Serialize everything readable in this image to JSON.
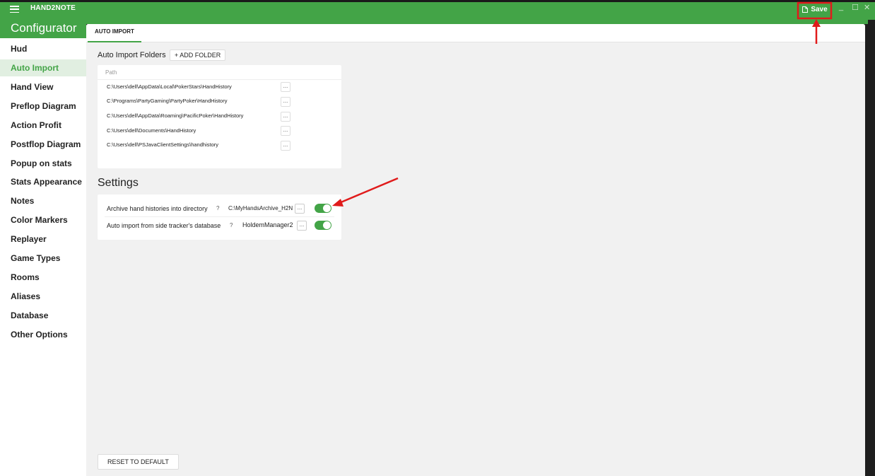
{
  "app": {
    "name": "HAND2NOTE"
  },
  "titlebar": {
    "save_label": "Save",
    "minimize": "_",
    "maximize": "☐",
    "close": "✕"
  },
  "sidebar": {
    "title": "Configurator",
    "items": [
      {
        "label": "Hud"
      },
      {
        "label": "Auto Import",
        "active": true
      },
      {
        "label": "Hand View"
      },
      {
        "label": "Preflop Diagram"
      },
      {
        "label": "Action Profit"
      },
      {
        "label": "Postflop Diagram"
      },
      {
        "label": "Popup on stats"
      },
      {
        "label": "Stats Appearance"
      },
      {
        "label": "Notes"
      },
      {
        "label": "Color Markers"
      },
      {
        "label": "Replayer"
      },
      {
        "label": "Game Types"
      },
      {
        "label": "Rooms"
      },
      {
        "label": "Aliases"
      },
      {
        "label": "Database"
      },
      {
        "label": "Other Options"
      }
    ]
  },
  "tabs": [
    {
      "label": "AUTO IMPORT",
      "active": true
    }
  ],
  "auto_import": {
    "folders_label": "Auto Import Folders",
    "add_folder_label": "+ ADD FOLDER",
    "path_header": "Path",
    "browse_label": "...",
    "paths": [
      "C:\\Users\\dell\\AppData\\Local\\PokerStars\\HandHistory",
      "C:\\Programs\\PartyGaming\\PartyPoker\\HandHistory",
      "C:\\Users\\dell\\AppData\\Roaming\\PacificPoker\\HandHistory",
      "C:\\Users\\dell\\Documents\\HandHistory",
      "C:\\Users\\dell\\PSJavaClientSettings\\handhistory"
    ]
  },
  "settings": {
    "title": "Settings",
    "help": "?",
    "rows": [
      {
        "label": "Archive hand histories into directory",
        "value": "C:\\MyHandsArchive_H2N",
        "enabled": true
      },
      {
        "label": "Auto import from side tracker's database",
        "value": "HoldemManager2",
        "enabled": true
      }
    ]
  },
  "footer": {
    "reset_label": "RESET TO DEFAULT"
  },
  "colors": {
    "accent": "#43a447",
    "annotation": "#e01b1b"
  }
}
